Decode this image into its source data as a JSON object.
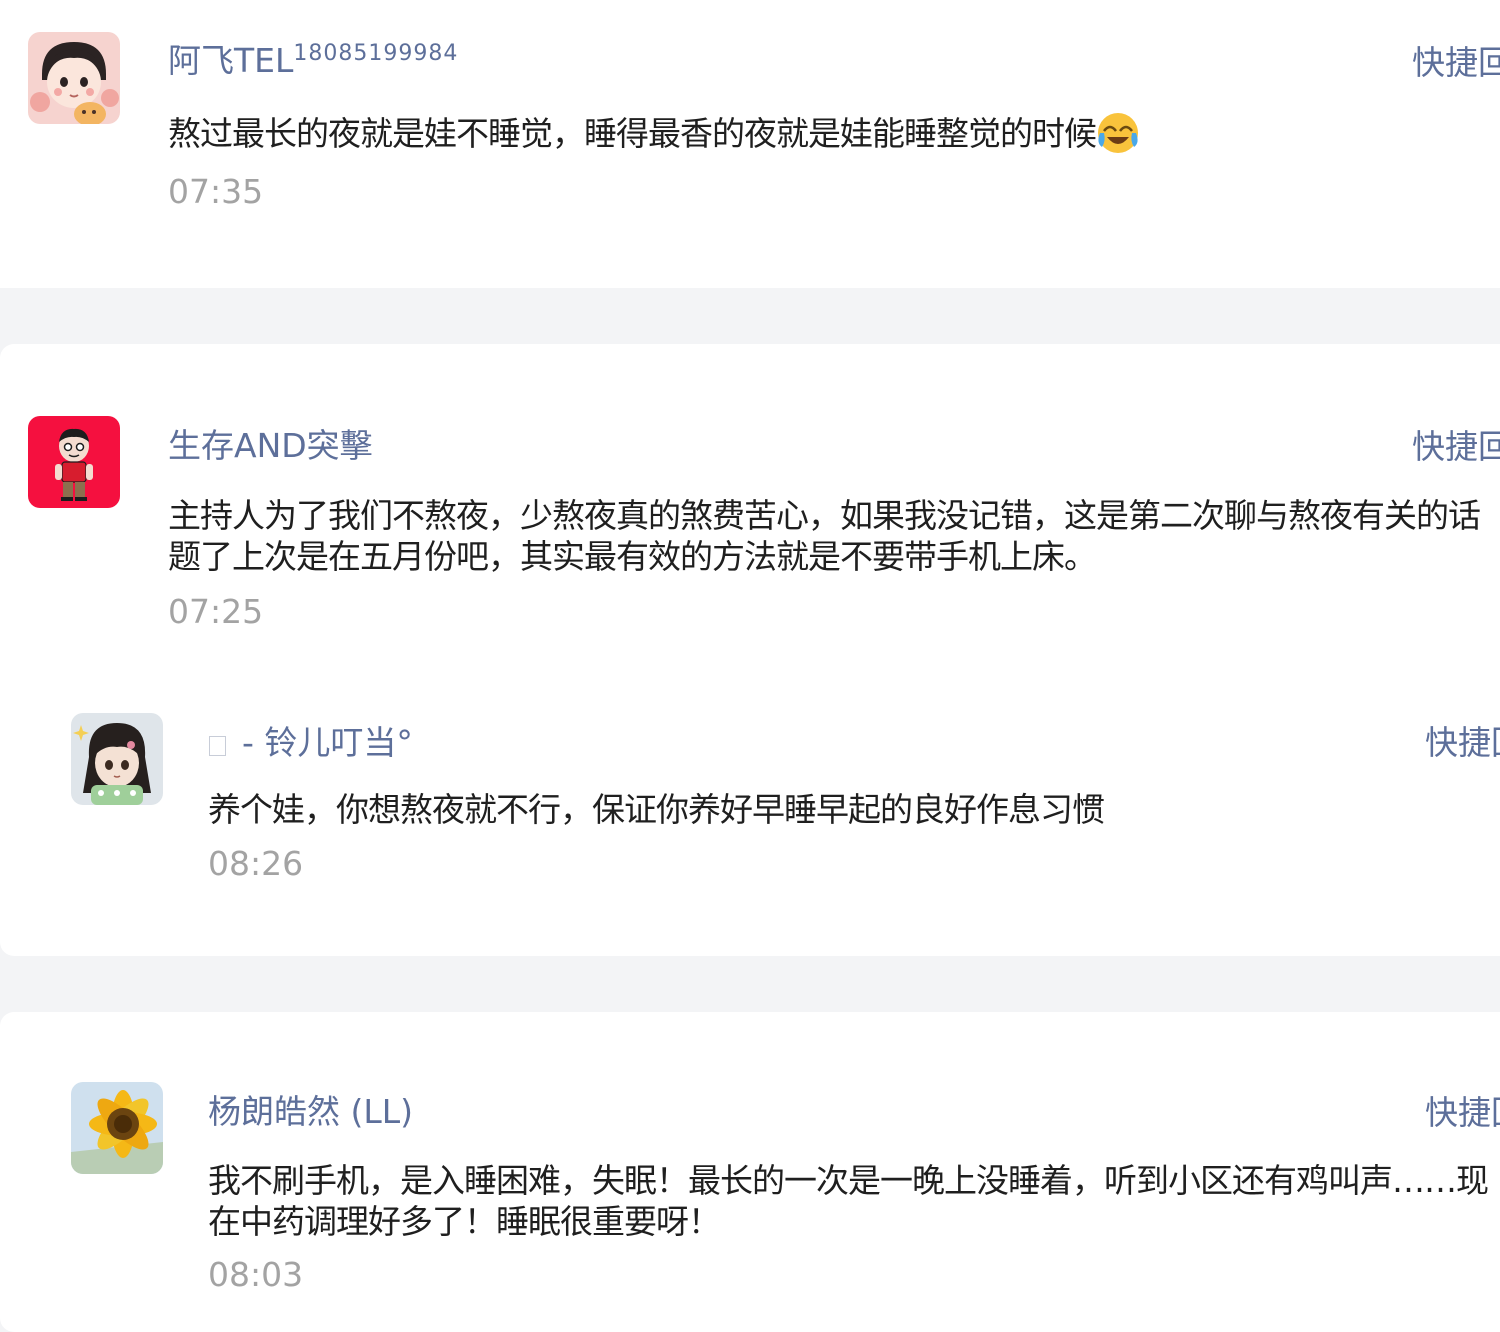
{
  "comments": [
    {
      "username": "阿飞TEL",
      "username_suffix": "18085199984",
      "content": "熬过最长的夜就是娃不睡觉，睡得最香的夜就是娃能睡整觉的时候",
      "emoji": "crying-laughing-emoji",
      "time": "07:35",
      "quick_reply": "快捷回"
    },
    {
      "username": "生存AND突擊",
      "content": "主持人为了我们不熬夜，少熬夜真的煞费苦心，如果我没记错，这是第二次聊与熬夜有关的话题了上次是在五月份吧，其实最有效的方法就是不要带手机上床。",
      "time": "07:25",
      "quick_reply": "快捷回",
      "replies": [
        {
          "username": "- 铃儿叮当°",
          "content": "养个娃，你想熬夜就不行，保证你养好早睡早起的良好作息习惯",
          "time": "08:26",
          "quick_reply": "快捷回"
        }
      ]
    },
    {
      "username": "杨朗皓然 (LL)",
      "content": "我不刷手机，是入睡困难，失眠！最长的一次是一晚上没睡着，听到小区还有鸡叫声……现在中药调理好多了！睡眠很重要呀！",
      "time": "08:03",
      "quick_reply": "快捷回"
    }
  ],
  "colors": {
    "username": "#5d6f9a",
    "content": "#1f1f1f",
    "time": "#a3a3a3",
    "separator": "#f3f4f6"
  }
}
